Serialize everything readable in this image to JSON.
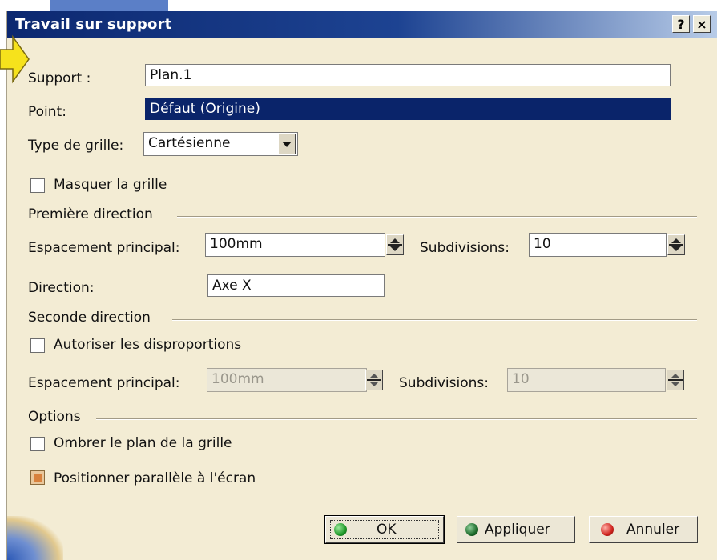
{
  "dialog": {
    "title": "Travail sur support",
    "help_label": "?",
    "close_label": "×"
  },
  "support": {
    "label": "Support :",
    "value": "Plan.1"
  },
  "point": {
    "label": "Point:",
    "value": "Défaut (Origine)"
  },
  "grid_type": {
    "label": "Type de grille:",
    "value": "Cartésienne"
  },
  "hide_grid": {
    "label": "Masquer la grille",
    "checked": false
  },
  "first_direction": {
    "group_label": "Première direction",
    "spacing_label": "Espacement principal:",
    "spacing_value": "100mm",
    "subdiv_label": "Subdivisions:",
    "subdiv_value": "10",
    "direction_label": "Direction:",
    "direction_value": "Axe X"
  },
  "second_direction": {
    "group_label": "Seconde direction",
    "allow_label": "Autoriser les disproportions",
    "allow_checked": false,
    "spacing_label": "Espacement principal:",
    "spacing_value": "100mm",
    "subdiv_label": "Subdivisions:",
    "subdiv_value": "10"
  },
  "options": {
    "group_label": "Options",
    "shade_label": "Ombrer le plan de la grille",
    "shade_checked": false,
    "parallel_label": "Positionner parallèle à l'écran",
    "parallel_checked": true
  },
  "buttons": {
    "ok_label": "OK",
    "apply_label": "Appliquer",
    "cancel_label": "Annuler"
  },
  "colors": {
    "ok_dot": "#1f9a2a",
    "apply_dot": "#1b6a2a",
    "cancel_dot": "#d0231e"
  }
}
